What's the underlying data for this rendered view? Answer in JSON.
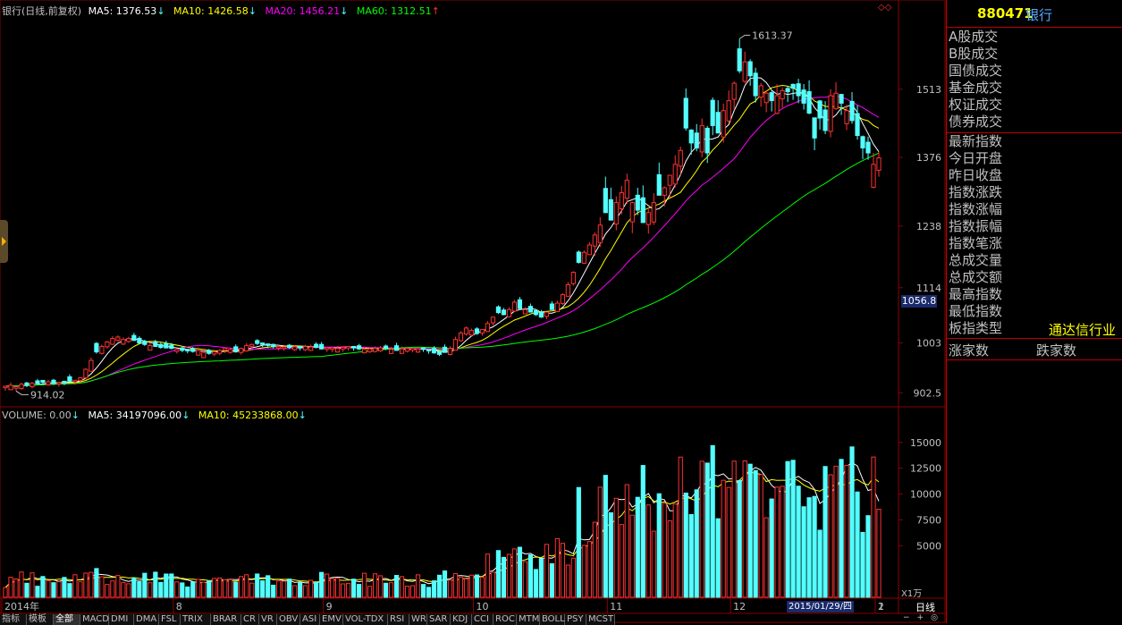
{
  "header": {
    "title": "银行(日线,前复权)",
    "ma5": "MA5: 1376.53",
    "ma10": "MA10: 1426.58",
    "ma20": "MA20: 1456.21",
    "ma60": "MA60: 1312.51",
    "arrow_down": "↓",
    "arrow_up": "↑"
  },
  "volume_header": {
    "volume": "VOLUME: 0.00",
    "ma5": "MA5: 34197096.00",
    "ma10": "MA10: 45233868.00",
    "arrow_down": "↓"
  },
  "colors": {
    "up": "#ff3232",
    "down": "#54ffff",
    "ma5": "#ffffff",
    "ma10": "#ffff00",
    "ma20": "#ff00ff",
    "ma60": "#00ff00",
    "grid": "#8b0000",
    "axis_text": "#c0c0c0"
  },
  "price_axis": {
    "ticks": [
      "1513",
      "1376",
      "1238",
      "1114",
      "1003",
      "902.5"
    ],
    "current_label": "1056.8"
  },
  "volume_axis": {
    "ticks": [
      "15000",
      "12500",
      "10000",
      "7500",
      "5000"
    ],
    "unit": "X1万"
  },
  "time_axis": {
    "labels": [
      "2014年",
      "8",
      "9",
      "10",
      "11",
      "12",
      "1",
      "2"
    ],
    "cursor_date": "2015/01/29/四",
    "period": "日线"
  },
  "annotations": {
    "high": "1613.37",
    "low": "914.02"
  },
  "sidebar": {
    "code": "880471",
    "name": "银行",
    "group1": [
      "A股成交",
      "B股成交",
      "国债成交",
      "基金成交",
      "权证成交",
      "债券成交"
    ],
    "group2": [
      "最新指数",
      "今日开盘",
      "昨日收盘",
      "指数涨跌",
      "指数涨幅",
      "指数振幅",
      "指数笔涨",
      "总成交量",
      "总成交额",
      "最高指数",
      "最低指数",
      "板指类型"
    ],
    "board_type_value": "通达信行业",
    "bottom": [
      "涨家数",
      "跌家数"
    ]
  },
  "tabs": [
    "指标",
    "模板",
    "全部",
    "MACD",
    "DMI",
    "DMA",
    "FSL",
    "TRIX",
    "BRAR",
    "CR",
    "VR",
    "OBV",
    "ASI",
    "EMV",
    "VOL-TDX",
    "RSI",
    "WR",
    "SAR",
    "KDJ",
    "CCI",
    "ROC",
    "MTM",
    "BOLL",
    "PSY",
    "MCST"
  ],
  "chart_data": {
    "type": "candlestick",
    "title": "银行(日线,前复权)",
    "y_range": [
      880,
      1660
    ],
    "volume_range": [
      0,
      16800
    ],
    "volume_unit": "X1万",
    "series": [
      {
        "name": "MA5",
        "values": [
          1376.53
        ]
      },
      {
        "name": "MA10",
        "values": [
          1426.58
        ]
      },
      {
        "name": "MA20",
        "values": [
          1456.21
        ]
      },
      {
        "name": "MA60",
        "values": [
          1312.51
        ]
      }
    ],
    "close": [
      916,
      918,
      915,
      920,
      918,
      922,
      921,
      924,
      925,
      922,
      924,
      923,
      926,
      928,
      933,
      950,
      968,
      985,
      996,
      1005,
      1012,
      1015,
      1010,
      1012,
      1008,
      1003,
      1000,
      998,
      996,
      994,
      993,
      992,
      990,
      988,
      987,
      986,
      988,
      984,
      982,
      985,
      988,
      992,
      990,
      985,
      992,
      998,
      1000,
      1002,
      1000,
      998,
      996,
      996,
      995,
      994,
      995,
      993,
      996,
      995,
      994,
      991,
      993,
      993,
      992,
      994,
      996,
      993,
      991,
      990,
      991,
      992,
      993,
      992,
      990,
      988,
      991,
      992,
      992,
      991,
      990,
      987,
      983,
      980,
      984,
      992,
      1010,
      1023,
      1033,
      1028,
      1022,
      1030,
      1042,
      1055,
      1064,
      1060,
      1070,
      1085,
      1072,
      1070,
      1065,
      1060,
      1055,
      1065,
      1070,
      1083,
      1100,
      1120,
      1145,
      1165,
      1185,
      1200,
      1220,
      1240,
      1265,
      1250,
      1285,
      1305,
      1330,
      1285,
      1270,
      1245,
      1265,
      1285,
      1300,
      1315,
      1340,
      1362,
      1390,
      1435,
      1405,
      1395,
      1440,
      1385,
      1440,
      1425,
      1470,
      1490,
      1525,
      1550,
      1568,
      1540,
      1500,
      1520,
      1505,
      1490,
      1500,
      1510,
      1508,
      1515,
      1500,
      1485,
      1465,
      1415,
      1455,
      1430,
      1500,
      1505,
      1485,
      1470,
      1450,
      1420,
      1395,
      1385,
      1362,
      1375
    ]
  }
}
